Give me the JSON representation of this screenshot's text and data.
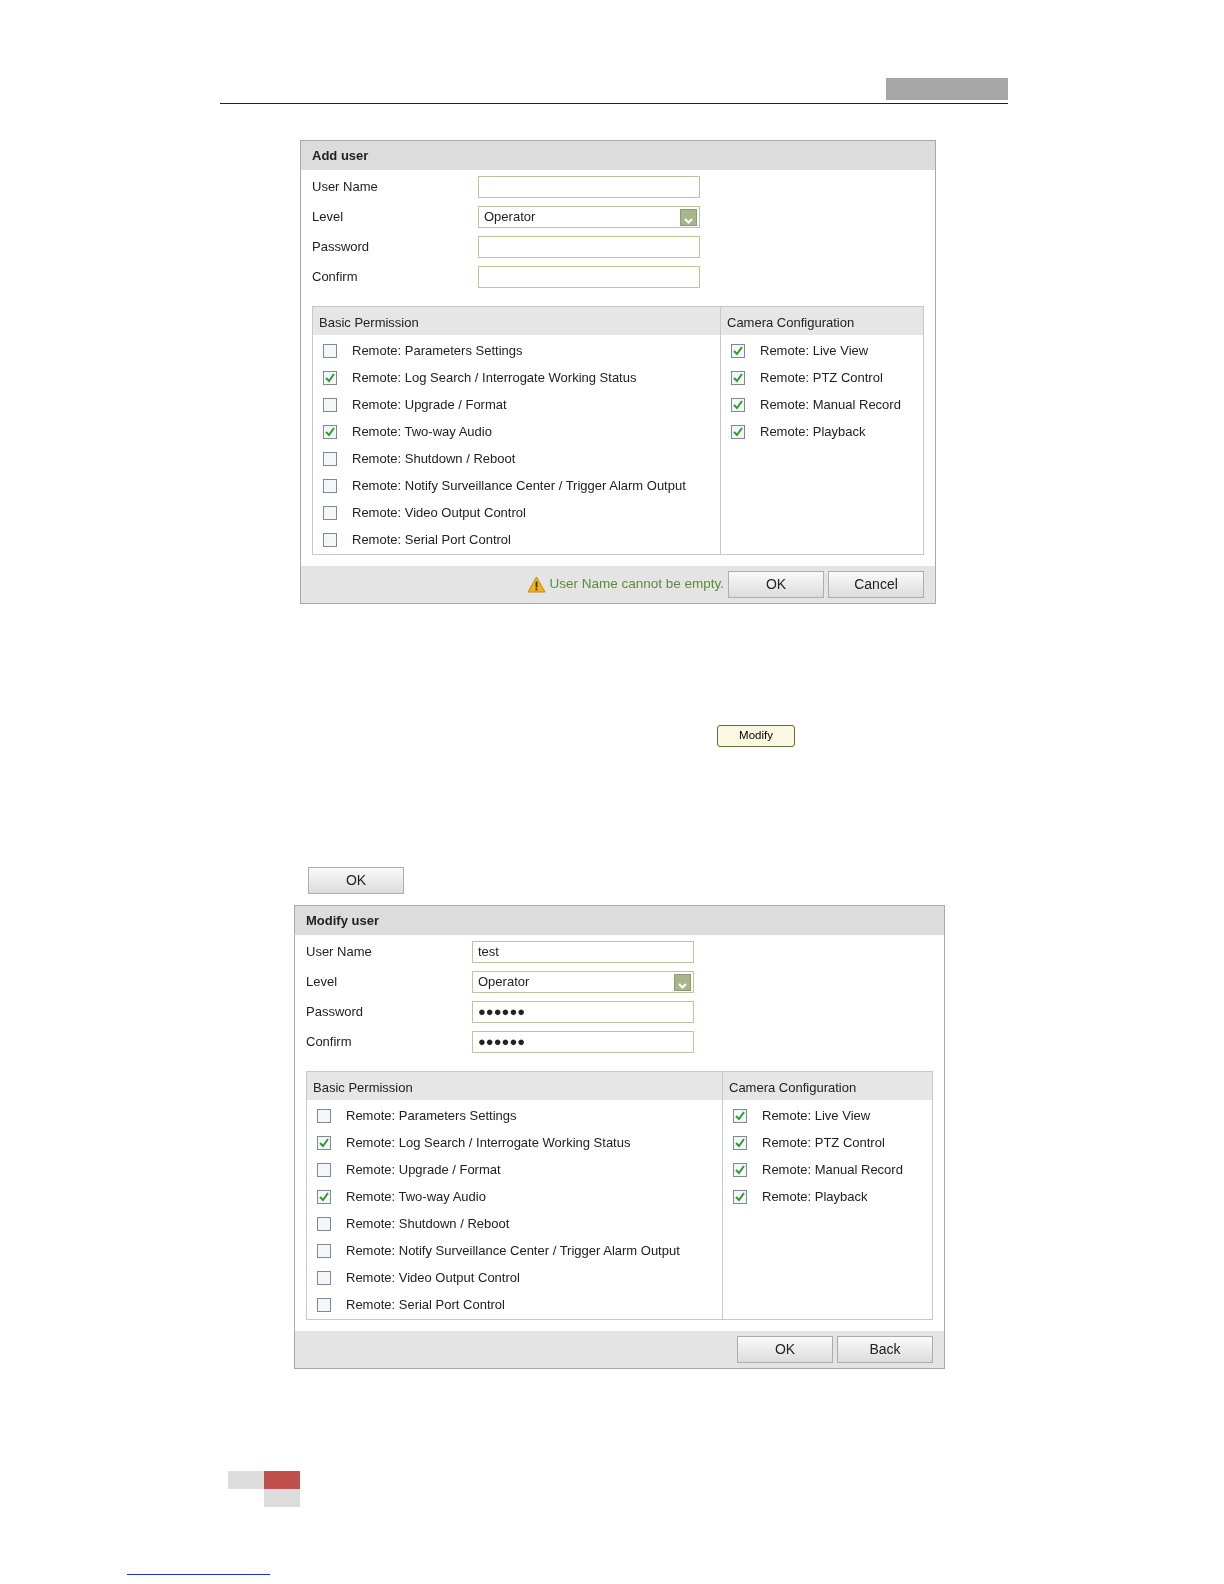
{
  "content": [
    {
      "kind": "dialog",
      "title": "Add user",
      "fields": [
        {
          "label": "User Name",
          "kind": "text"
        },
        {
          "label": "Level",
          "kind": "select",
          "value": "Operator"
        },
        {
          "label": "Password",
          "kind": "password"
        },
        {
          "label": "Confirm",
          "kind": "password"
        }
      ],
      "groups": [
        {
          "title": "Basic Permission",
          "items": [
            {
              "label": "Remote: Parameters Settings",
              "checked": false
            },
            {
              "label": "Remote: Log Search / Interrogate Working Status",
              "checked": true
            },
            {
              "label": "Remote: Upgrade / Format",
              "checked": false
            },
            {
              "label": "Remote: Two-way Audio",
              "checked": true
            },
            {
              "label": "Remote: Shutdown / Reboot",
              "checked": false
            },
            {
              "label": "Remote: Notify Surveillance Center / Trigger Alarm Output",
              "checked": false
            },
            {
              "label": "Remote: Video Output Control",
              "checked": false
            },
            {
              "label": "Remote: Serial Port Control",
              "checked": false
            }
          ]
        },
        {
          "title": "Camera Configuration",
          "items": [
            {
              "label": "Remote: Live View",
              "checked": true
            },
            {
              "label": "Remote: PTZ Control",
              "checked": true
            },
            {
              "label": "Remote: Manual Record",
              "checked": true
            },
            {
              "label": "Remote: Playback",
              "checked": true
            }
          ]
        }
      ],
      "warning": "User Name cannot be empty.",
      "buttons": [
        "OK",
        "Cancel"
      ]
    },
    {
      "kind": "small_button",
      "label": "Modify"
    },
    {
      "kind": "button",
      "label": "OK"
    },
    {
      "kind": "dialog",
      "title": "Modify user",
      "fields": [
        {
          "label": "User Name",
          "kind": "text",
          "value": "test"
        },
        {
          "label": "Level",
          "kind": "select",
          "value": "Operator"
        },
        {
          "label": "Password",
          "kind": "password",
          "value": "●●●●●●"
        },
        {
          "label": "Confirm",
          "kind": "password",
          "value": "●●●●●●"
        }
      ],
      "groups": [
        {
          "title": "Basic Permission",
          "items": [
            {
              "label": "Remote: Parameters Settings",
              "checked": false
            },
            {
              "label": "Remote: Log Search / Interrogate Working Status",
              "checked": true
            },
            {
              "label": "Remote: Upgrade / Format",
              "checked": false
            },
            {
              "label": "Remote: Two-way Audio",
              "checked": true
            },
            {
              "label": "Remote: Shutdown / Reboot",
              "checked": false
            },
            {
              "label": "Remote: Notify Surveillance Center / Trigger Alarm Output",
              "checked": false
            },
            {
              "label": "Remote: Video Output Control",
              "checked": false
            },
            {
              "label": "Remote: Serial Port Control",
              "checked": false
            }
          ]
        },
        {
          "title": "Camera Configuration",
          "items": [
            {
              "label": "Remote: Live View",
              "checked": true
            },
            {
              "label": "Remote: PTZ Control",
              "checked": true
            },
            {
              "label": "Remote: Manual Record",
              "checked": true
            },
            {
              "label": "Remote: Playback",
              "checked": true
            }
          ]
        }
      ],
      "buttons": [
        "OK",
        "Back"
      ]
    }
  ]
}
